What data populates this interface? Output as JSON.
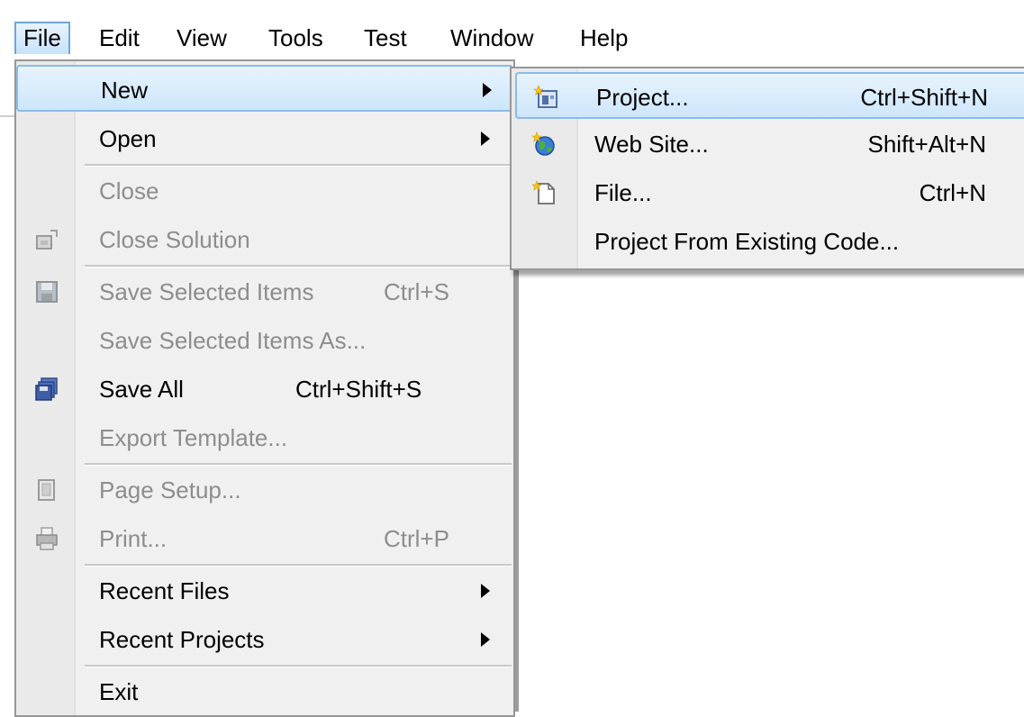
{
  "menubar": {
    "items": [
      {
        "label": "File",
        "active": true
      },
      {
        "label": "Edit"
      },
      {
        "label": "View"
      },
      {
        "label": "Tools"
      },
      {
        "label": "Test"
      },
      {
        "label": "Window"
      },
      {
        "label": "Help"
      }
    ]
  },
  "file_menu": {
    "new": "New",
    "open": "Open",
    "close": "Close",
    "close_solution": "Close Solution",
    "save_selected": "Save Selected Items",
    "save_selected_sc": "Ctrl+S",
    "save_selected_as": "Save Selected Items As...",
    "save_all": "Save All",
    "save_all_sc": "Ctrl+Shift+S",
    "export_template": "Export Template...",
    "page_setup": "Page Setup...",
    "print": "Print...",
    "print_sc": "Ctrl+P",
    "recent_files": "Recent Files",
    "recent_projects": "Recent Projects",
    "exit": "Exit"
  },
  "new_submenu": {
    "project": "Project...",
    "project_sc": "Ctrl+Shift+N",
    "web_site": "Web Site...",
    "web_site_sc": "Shift+Alt+N",
    "file": "File...",
    "file_sc": "Ctrl+N",
    "from_existing": "Project From Existing Code..."
  },
  "colors": {
    "hover_border": "#8bbbe8",
    "disabled_text": "#8d8d8d",
    "menu_bg": "#f0f0f0"
  }
}
